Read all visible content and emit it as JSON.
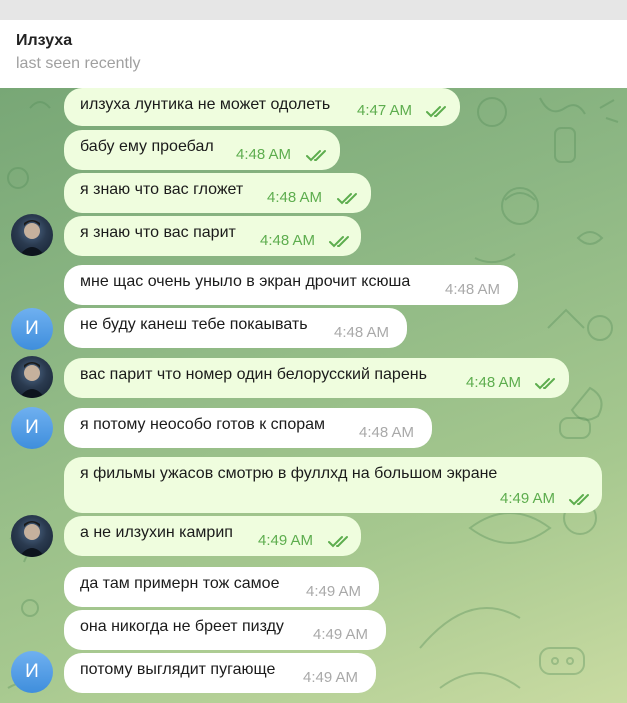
{
  "header": {
    "title": "Илзуха",
    "status": "last seen recently"
  },
  "avatar_letter": "И",
  "messages": [
    {
      "text": "илзуха лунтика не может одолеть",
      "time": "4:47 AM"
    },
    {
      "text": "бабу ему проебал",
      "time": "4:48 AM"
    },
    {
      "text": "я знаю что вас гложет",
      "time": "4:48 AM"
    },
    {
      "text": "я знаю что вас парит",
      "time": "4:48 AM"
    },
    {
      "text": "мне щас очень уныло в экран дрочит ксюша",
      "time": "4:48 AM"
    },
    {
      "text": "не буду канеш тебе покаывать",
      "time": "4:48 AM"
    },
    {
      "text": "вас парит что номер один белорусский парень",
      "time": "4:48 AM"
    },
    {
      "text": "я потому неособо готов к спорам",
      "time": "4:48 AM"
    },
    {
      "text": "я фильмы ужасов смотрю в фуллхд на большом экране",
      "time": "4:49 AM"
    },
    {
      "text": "а не илзухин камрип",
      "time": "4:49 AM"
    },
    {
      "text": "да там примерн тож самое",
      "time": "4:49 AM"
    },
    {
      "text": "она никогда не бреет пизду",
      "time": "4:49 AM"
    },
    {
      "text": "потому выглядит пугающе",
      "time": "4:49 AM"
    }
  ],
  "colors": {
    "outgoing_bubble": "#effdde",
    "incoming_bubble": "#ffffff",
    "read_check": "#5dad4e"
  }
}
